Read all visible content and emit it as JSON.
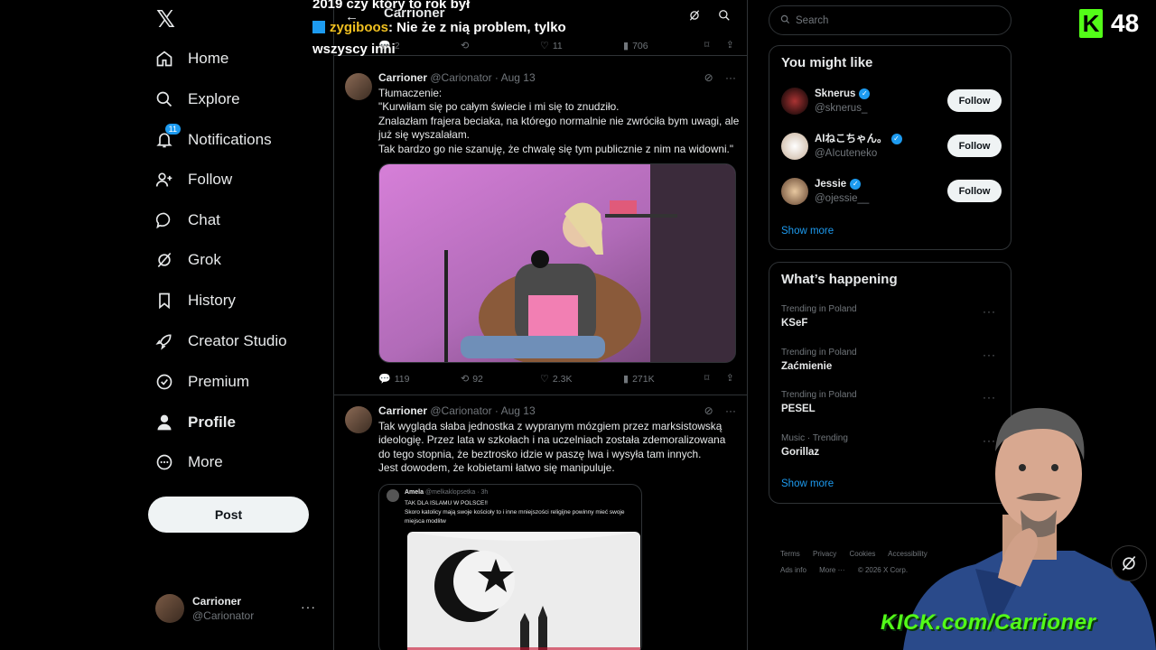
{
  "overlay": {
    "line1": "2019 czy który to rok był",
    "user": "zygiboos",
    "message": ": Nie że z nią problem, tylko",
    "line3": "wszyscy inni"
  },
  "kick": {
    "logo_letter": "K",
    "viewer_count": "48",
    "url": "KICK.com/Carrioner",
    "accent": "#53fc18"
  },
  "nav": {
    "logo": "𝕏",
    "items": [
      {
        "label": "Home",
        "icon": "home-icon"
      },
      {
        "label": "Explore",
        "icon": "search-icon"
      },
      {
        "label": "Notifications",
        "icon": "bell-icon",
        "badge": "11"
      },
      {
        "label": "Follow",
        "icon": "add-person-icon"
      },
      {
        "label": "Chat",
        "icon": "chat-icon"
      },
      {
        "label": "Grok",
        "icon": "grok-icon"
      },
      {
        "label": "History",
        "icon": "bookmark-icon"
      },
      {
        "label": "Creator Studio",
        "icon": "rocket-icon"
      },
      {
        "label": "Premium",
        "icon": "verified-icon"
      },
      {
        "label": "Profile",
        "icon": "person-icon"
      },
      {
        "label": "More",
        "icon": "more-circle-icon"
      }
    ],
    "post_label": "Post",
    "account": {
      "name": "Carrioner",
      "handle": "@Carionator",
      "more": "···"
    }
  },
  "header": {
    "title": "Carrioner"
  },
  "prev_actions": {
    "replies": "2",
    "likes": "11",
    "views": "706"
  },
  "tweets": [
    {
      "name": "Carrioner",
      "meta": "@Carionator · Aug 13",
      "text": "Tłumaczenie:\n\"Kurwiłam się po całym świecie i mi się to znudziło.\nZnalazłam frajera beciaka, na którego normalnie nie zwróciła bym uwagi, ale już się wyszalałam.\nTak bardzo go nie szanuję, że chwalę się tym publicznie z nim na widowni.\"",
      "replies": "119",
      "retweets": "92",
      "likes": "2.3K",
      "views": "271K"
    },
    {
      "name": "Carrioner",
      "meta": "@Carionator · Aug 13",
      "text": "Tak wygląda słaba jednostka z wypranym mózgiem przez marksistowską ideologię. Przez lata w szkołach i na uczelniach została zdemoralizowana do tego stopnia, że beztrosko idzie w paszę lwa i wysyła tam innych.\nJest dowodem, że kobietami łatwo się manipuluje.",
      "quote": {
        "name": "Amela",
        "handle": "@melkaklopsetka · 3h",
        "line1": "TAK DLA ISLAMU W POLSCE!!",
        "line2": "Skoro katolicy mają swoje kościoły to i inne mniejszości religijne powinny mieć swoje miejsca modlitw"
      }
    }
  ],
  "search": {
    "placeholder": "Search"
  },
  "who_to_follow": {
    "title": "You might like",
    "users": [
      {
        "name": "Sknerus",
        "handle": "@sknerus_",
        "follow": "Follow"
      },
      {
        "name": "AIねこちゃん。",
        "handle": "@AIcuteneko",
        "follow": "Follow"
      },
      {
        "name": "Jessie",
        "handle": "@ojessie__",
        "follow": "Follow"
      }
    ],
    "show_more": "Show more"
  },
  "happening": {
    "title": "What’s happening",
    "trends": [
      {
        "context": "Trending in Poland",
        "topic": "KSeF"
      },
      {
        "context": "Trending in Poland",
        "topic": "Zaćmienie"
      },
      {
        "context": "Trending in Poland",
        "topic": "PESEL"
      },
      {
        "context": "Music · Trending",
        "topic": "Gorillaz"
      }
    ],
    "show_more": "Show more"
  },
  "footer": {
    "links": [
      "Terms",
      "Privacy",
      "Cookies",
      "Accessibility",
      "Ads info",
      "More ···",
      "© 2026 X Corp."
    ]
  }
}
